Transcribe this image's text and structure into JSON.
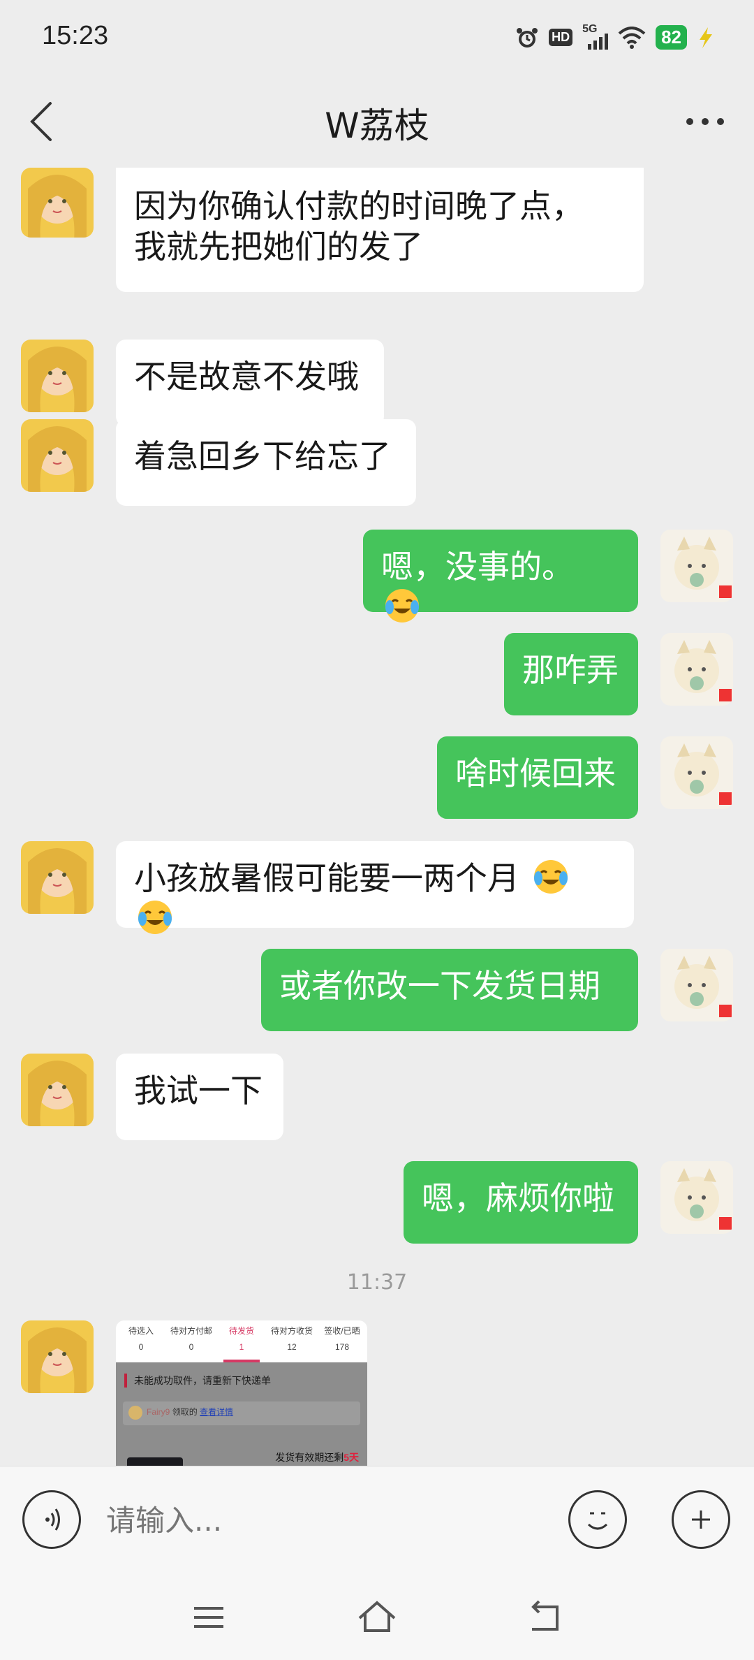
{
  "status": {
    "time": "15:23",
    "network": "5G",
    "hd": "HD",
    "battery": "82"
  },
  "header": {
    "title": "W荔枝"
  },
  "messages": [
    {
      "side": "left",
      "text_line1": "因为你确认付款的时间晚了点，",
      "text_line2": "我就先把她们的发了"
    },
    {
      "side": "left",
      "text": "不是故意不发哦"
    },
    {
      "side": "left",
      "text": "着急回乡下给忘了"
    },
    {
      "side": "right",
      "text": "嗯，没事的。",
      "emoji": "laughing-crying-emoji"
    },
    {
      "side": "right",
      "text": "那咋弄"
    },
    {
      "side": "right",
      "text": "啥时候回来"
    },
    {
      "side": "left",
      "text": "小孩放暑假可能要一两个月",
      "emoji": "laughing-crying-emoji"
    },
    {
      "side": "right",
      "text": "或者你改一下发货日期"
    },
    {
      "side": "left",
      "text": "我试一下"
    },
    {
      "side": "right",
      "text": "嗯，麻烦你啦"
    }
  ],
  "timestamp": "11:37",
  "screenshot_message": {
    "tabs": [
      {
        "label": "待选入",
        "count": "0"
      },
      {
        "label": "待对方付邮",
        "count": "0"
      },
      {
        "label": "待发货",
        "count": "1"
      },
      {
        "label": "待对方收货",
        "count": "12"
      },
      {
        "label": "签收/已晒",
        "count": "178"
      }
    ],
    "notice": "未能成功取件，请重新下快递单",
    "card_user": "Fairy9",
    "card_text": "领取的",
    "card_link": "查看详情",
    "deadline_prefix": "发货有效期还剩",
    "deadline_days": "5天"
  },
  "input": {
    "placeholder": "请输入..."
  },
  "colors": {
    "sent_bubble": "#45c45b",
    "received_bubble": "#ffffff",
    "background": "#ededed"
  }
}
